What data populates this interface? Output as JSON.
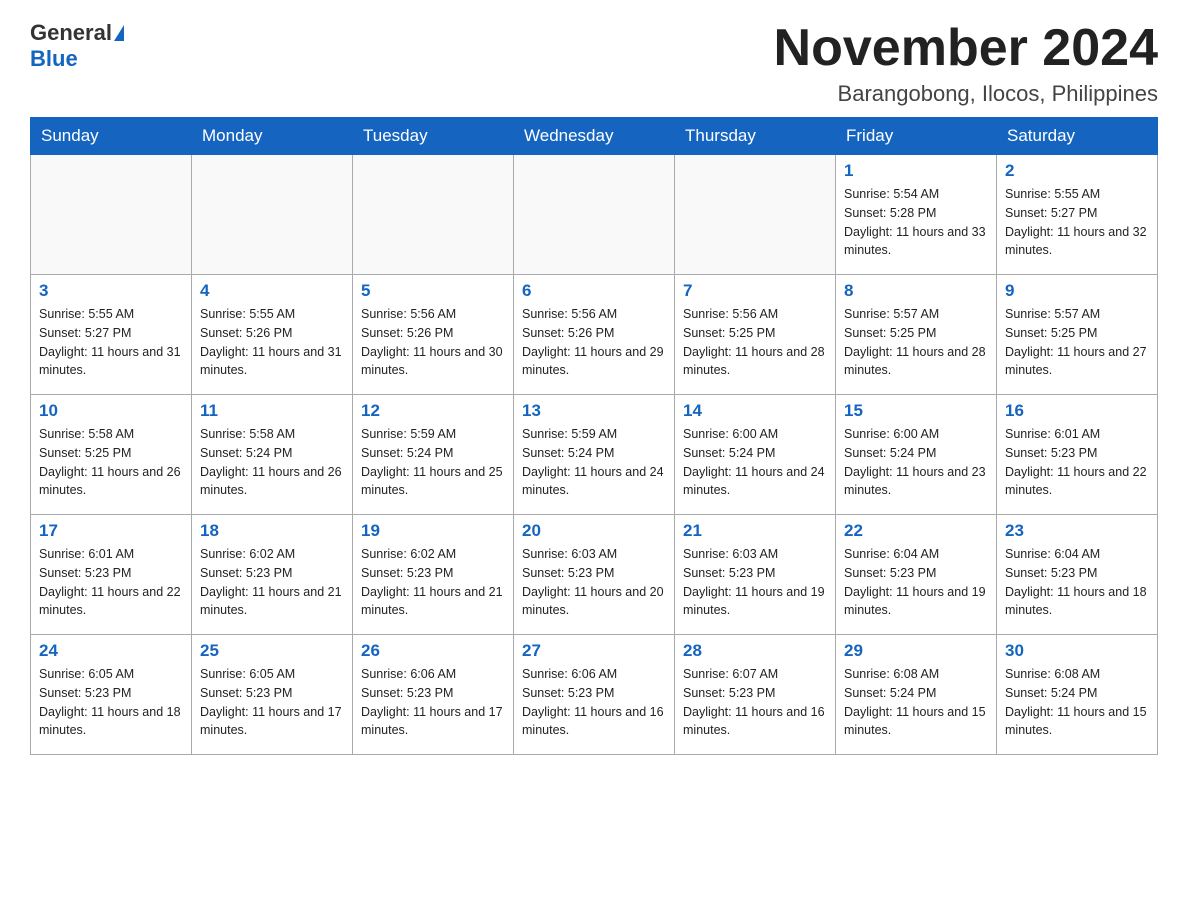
{
  "logo": {
    "general": "General",
    "blue": "Blue"
  },
  "title": "November 2024",
  "location": "Barangobong, Ilocos, Philippines",
  "weekdays": [
    "Sunday",
    "Monday",
    "Tuesday",
    "Wednesday",
    "Thursday",
    "Friday",
    "Saturday"
  ],
  "weeks": [
    [
      {
        "day": "",
        "info": ""
      },
      {
        "day": "",
        "info": ""
      },
      {
        "day": "",
        "info": ""
      },
      {
        "day": "",
        "info": ""
      },
      {
        "day": "",
        "info": ""
      },
      {
        "day": "1",
        "info": "Sunrise: 5:54 AM\nSunset: 5:28 PM\nDaylight: 11 hours and 33 minutes."
      },
      {
        "day": "2",
        "info": "Sunrise: 5:55 AM\nSunset: 5:27 PM\nDaylight: 11 hours and 32 minutes."
      }
    ],
    [
      {
        "day": "3",
        "info": "Sunrise: 5:55 AM\nSunset: 5:27 PM\nDaylight: 11 hours and 31 minutes."
      },
      {
        "day": "4",
        "info": "Sunrise: 5:55 AM\nSunset: 5:26 PM\nDaylight: 11 hours and 31 minutes."
      },
      {
        "day": "5",
        "info": "Sunrise: 5:56 AM\nSunset: 5:26 PM\nDaylight: 11 hours and 30 minutes."
      },
      {
        "day": "6",
        "info": "Sunrise: 5:56 AM\nSunset: 5:26 PM\nDaylight: 11 hours and 29 minutes."
      },
      {
        "day": "7",
        "info": "Sunrise: 5:56 AM\nSunset: 5:25 PM\nDaylight: 11 hours and 28 minutes."
      },
      {
        "day": "8",
        "info": "Sunrise: 5:57 AM\nSunset: 5:25 PM\nDaylight: 11 hours and 28 minutes."
      },
      {
        "day": "9",
        "info": "Sunrise: 5:57 AM\nSunset: 5:25 PM\nDaylight: 11 hours and 27 minutes."
      }
    ],
    [
      {
        "day": "10",
        "info": "Sunrise: 5:58 AM\nSunset: 5:25 PM\nDaylight: 11 hours and 26 minutes."
      },
      {
        "day": "11",
        "info": "Sunrise: 5:58 AM\nSunset: 5:24 PM\nDaylight: 11 hours and 26 minutes."
      },
      {
        "day": "12",
        "info": "Sunrise: 5:59 AM\nSunset: 5:24 PM\nDaylight: 11 hours and 25 minutes."
      },
      {
        "day": "13",
        "info": "Sunrise: 5:59 AM\nSunset: 5:24 PM\nDaylight: 11 hours and 24 minutes."
      },
      {
        "day": "14",
        "info": "Sunrise: 6:00 AM\nSunset: 5:24 PM\nDaylight: 11 hours and 24 minutes."
      },
      {
        "day": "15",
        "info": "Sunrise: 6:00 AM\nSunset: 5:24 PM\nDaylight: 11 hours and 23 minutes."
      },
      {
        "day": "16",
        "info": "Sunrise: 6:01 AM\nSunset: 5:23 PM\nDaylight: 11 hours and 22 minutes."
      }
    ],
    [
      {
        "day": "17",
        "info": "Sunrise: 6:01 AM\nSunset: 5:23 PM\nDaylight: 11 hours and 22 minutes."
      },
      {
        "day": "18",
        "info": "Sunrise: 6:02 AM\nSunset: 5:23 PM\nDaylight: 11 hours and 21 minutes."
      },
      {
        "day": "19",
        "info": "Sunrise: 6:02 AM\nSunset: 5:23 PM\nDaylight: 11 hours and 21 minutes."
      },
      {
        "day": "20",
        "info": "Sunrise: 6:03 AM\nSunset: 5:23 PM\nDaylight: 11 hours and 20 minutes."
      },
      {
        "day": "21",
        "info": "Sunrise: 6:03 AM\nSunset: 5:23 PM\nDaylight: 11 hours and 19 minutes."
      },
      {
        "day": "22",
        "info": "Sunrise: 6:04 AM\nSunset: 5:23 PM\nDaylight: 11 hours and 19 minutes."
      },
      {
        "day": "23",
        "info": "Sunrise: 6:04 AM\nSunset: 5:23 PM\nDaylight: 11 hours and 18 minutes."
      }
    ],
    [
      {
        "day": "24",
        "info": "Sunrise: 6:05 AM\nSunset: 5:23 PM\nDaylight: 11 hours and 18 minutes."
      },
      {
        "day": "25",
        "info": "Sunrise: 6:05 AM\nSunset: 5:23 PM\nDaylight: 11 hours and 17 minutes."
      },
      {
        "day": "26",
        "info": "Sunrise: 6:06 AM\nSunset: 5:23 PM\nDaylight: 11 hours and 17 minutes."
      },
      {
        "day": "27",
        "info": "Sunrise: 6:06 AM\nSunset: 5:23 PM\nDaylight: 11 hours and 16 minutes."
      },
      {
        "day": "28",
        "info": "Sunrise: 6:07 AM\nSunset: 5:23 PM\nDaylight: 11 hours and 16 minutes."
      },
      {
        "day": "29",
        "info": "Sunrise: 6:08 AM\nSunset: 5:24 PM\nDaylight: 11 hours and 15 minutes."
      },
      {
        "day": "30",
        "info": "Sunrise: 6:08 AM\nSunset: 5:24 PM\nDaylight: 11 hours and 15 minutes."
      }
    ]
  ]
}
